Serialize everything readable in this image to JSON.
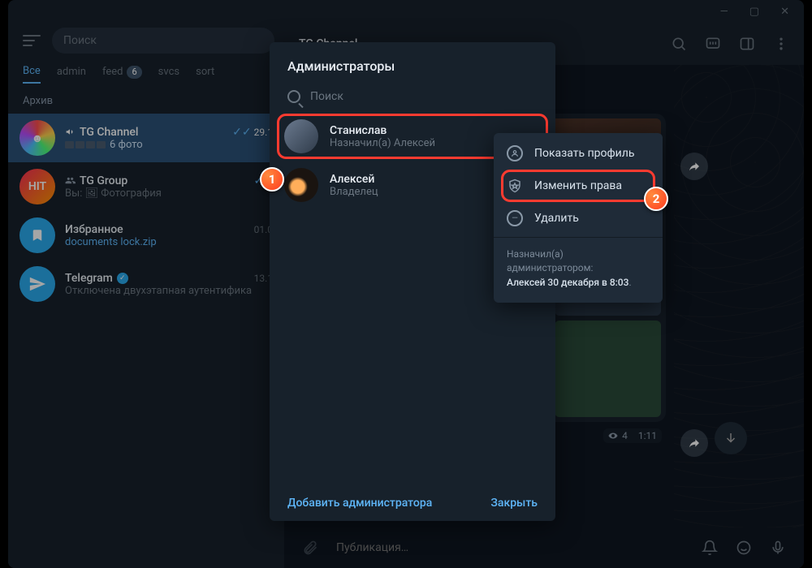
{
  "titlebar": {
    "minimize": "—",
    "maximize": "▢",
    "close": "✕"
  },
  "search": {
    "placeholder": "Поиск"
  },
  "folders": [
    {
      "label": "Все",
      "active": true
    },
    {
      "label": "admin"
    },
    {
      "label": "feed",
      "badge": "6"
    },
    {
      "label": "svcs"
    },
    {
      "label": "sort"
    }
  ],
  "archive_label": "Архив",
  "chats": [
    {
      "name": "TG Channel",
      "icon": "megaphone",
      "sub": "6 фото",
      "time": "29.1",
      "checks": true,
      "active": true,
      "avatar": "rainbow",
      "photos": true
    },
    {
      "name": "TG Group",
      "icon": "group",
      "sub": "Вы: 🖼 Фотография",
      "time": "",
      "checks": true,
      "avatar": "hit",
      "avatar_text": "HIT"
    },
    {
      "name": "Избранное",
      "icon": "",
      "sub": "documents lock.zip",
      "sub_link": true,
      "time": "01.0",
      "avatar": "saved",
      "avatar_icon": "bookmark"
    },
    {
      "name": "Telegram",
      "icon": "",
      "verified": true,
      "sub": "Отключена двухэтапная аутентифика",
      "time": "13.1",
      "avatar": "tele",
      "avatar_icon": "plane"
    }
  ],
  "right_header": {
    "title": "TG Channel"
  },
  "compose": {
    "placeholder": "Публикация…"
  },
  "media_caption": {
    "views": "4",
    "time": "1:11"
  },
  "dialog": {
    "title": "Администраторы",
    "search_placeholder": "Поиск",
    "admins": [
      {
        "name": "Станислав",
        "sub": "Назначил(а) Алексей",
        "highlighted": true
      },
      {
        "name": "Алексей",
        "sub": "Владелец"
      }
    ],
    "add_label": "Добавить администратора",
    "close_label": "Закрыть"
  },
  "ctxmenu": {
    "show_profile": "Показать профиль",
    "edit_rights": "Изменить права",
    "remove": "Удалить",
    "info_line1": "Назначил(а) администратором:",
    "info_line2": "Алексей 30 декабря в 8:03"
  },
  "callouts": {
    "one": "1",
    "two": "2"
  }
}
